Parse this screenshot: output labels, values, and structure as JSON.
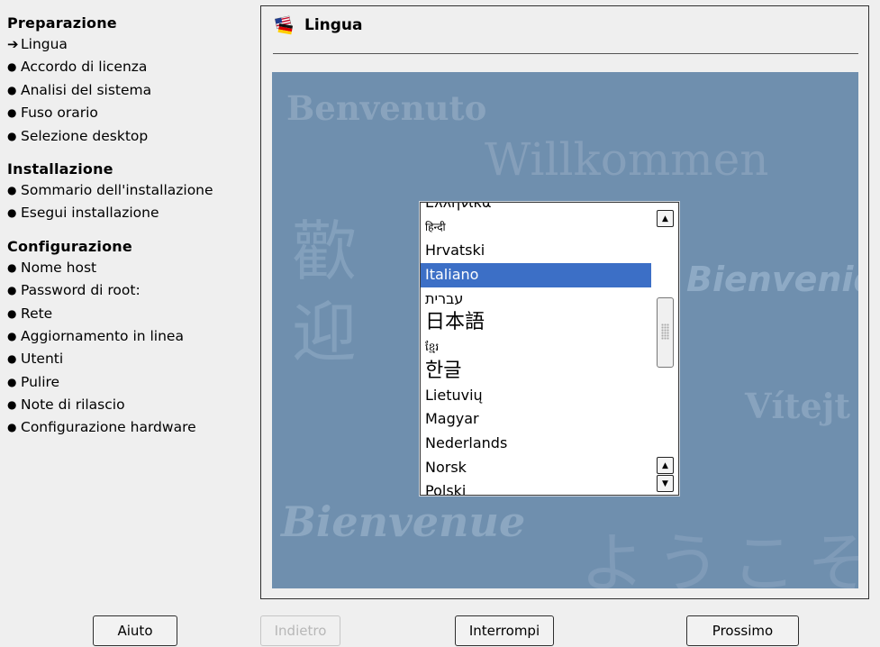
{
  "sidebar": {
    "sections": [
      {
        "title": "Preparazione",
        "steps": [
          {
            "label": "Lingua",
            "state": "current"
          },
          {
            "label": "Accordo di licenza",
            "state": "pending"
          },
          {
            "label": "Analisi del sistema",
            "state": "pending"
          },
          {
            "label": "Fuso orario",
            "state": "pending"
          },
          {
            "label": "Selezione desktop",
            "state": "pending"
          }
        ]
      },
      {
        "title": "Installazione",
        "steps": [
          {
            "label": "Sommario dell'installazione",
            "state": "pending"
          },
          {
            "label": "Esegui installazione",
            "state": "pending"
          }
        ]
      },
      {
        "title": "Configurazione",
        "steps": [
          {
            "label": "Nome host",
            "state": "pending"
          },
          {
            "label": "Password di root:",
            "state": "pending"
          },
          {
            "label": "Rete",
            "state": "pending"
          },
          {
            "label": "Aggiornamento in linea",
            "state": "pending"
          },
          {
            "label": "Utenti",
            "state": "pending"
          },
          {
            "label": "Pulire",
            "state": "pending"
          },
          {
            "label": "Note di rilascio",
            "state": "pending"
          },
          {
            "label": "Configurazione hardware",
            "state": "pending"
          }
        ]
      }
    ],
    "current_marker_icon": "arrow-right-icon",
    "pending_marker_icon": "bullet-icon"
  },
  "header": {
    "title": "Lingua",
    "icon": "flags-icon"
  },
  "welcome": {
    "words": {
      "benvenuto": "Benvenuto",
      "willkommen": "Willkommen",
      "cn1": "歡",
      "cn2": "迎",
      "bienvenid": "Bienvenid",
      "vitej": "Vítejt",
      "bienvenue": "Bienvenue",
      "yokoso": "ようこそ"
    }
  },
  "language_list": {
    "items": [
      {
        "label": "Eλληνικά",
        "size": "normal"
      },
      {
        "label": "हिन्दी",
        "size": "small"
      },
      {
        "label": "Hrvatski",
        "size": "normal"
      },
      {
        "label": "Italiano",
        "size": "normal",
        "selected": true
      },
      {
        "label": "עברית",
        "size": "normal"
      },
      {
        "label": "日本語",
        "size": "big"
      },
      {
        "label": "ខ្មែរ",
        "size": "small"
      },
      {
        "label": "한글",
        "size": "big"
      },
      {
        "label": "Lietuvių",
        "size": "normal"
      },
      {
        "label": "Magyar",
        "size": "normal"
      },
      {
        "label": "Nederlands",
        "size": "normal"
      },
      {
        "label": "Norsk",
        "size": "normal"
      },
      {
        "label": "Polski",
        "size": "normal"
      }
    ],
    "selected": "Italiano",
    "scroll_up_icon": "triangle-up-icon",
    "scroll_down_icon": "triangle-down-icon"
  },
  "buttons": {
    "help": "Aiuto",
    "back": "Indietro",
    "abort": "Interrompi",
    "next": "Prossimo"
  },
  "colors": {
    "window_bg": "#efefef",
    "welcome_bg": "#6f8fae",
    "selection": "#3c6fc6"
  }
}
